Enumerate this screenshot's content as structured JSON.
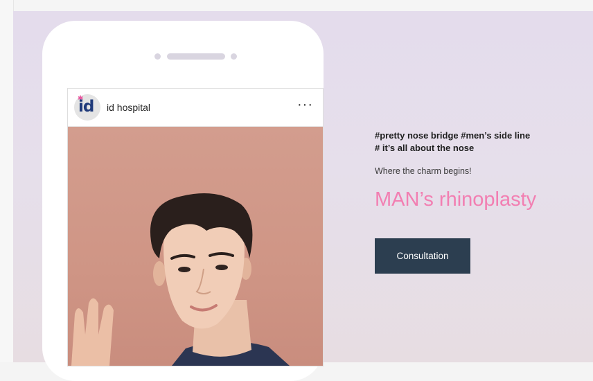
{
  "post": {
    "account_name": "id hospital",
    "avatar_text": "id",
    "more_label": "···"
  },
  "content": {
    "hashtags_line1": "#pretty nose bridge #men’s side line",
    "hashtags_line2": "# it’s all about the nose",
    "tagline": "Where the charm begins!",
    "headline": "MAN’s rhinoplasty",
    "cta_label": "Consultation"
  },
  "colors": {
    "headline": "#f27fb2",
    "button": "#2c3e50",
    "brand_blue": "#1f3a7a",
    "brand_pink": "#e9579f"
  },
  "icons": {
    "avatar": "id-hospital-logo",
    "more": "more-dots-icon"
  }
}
